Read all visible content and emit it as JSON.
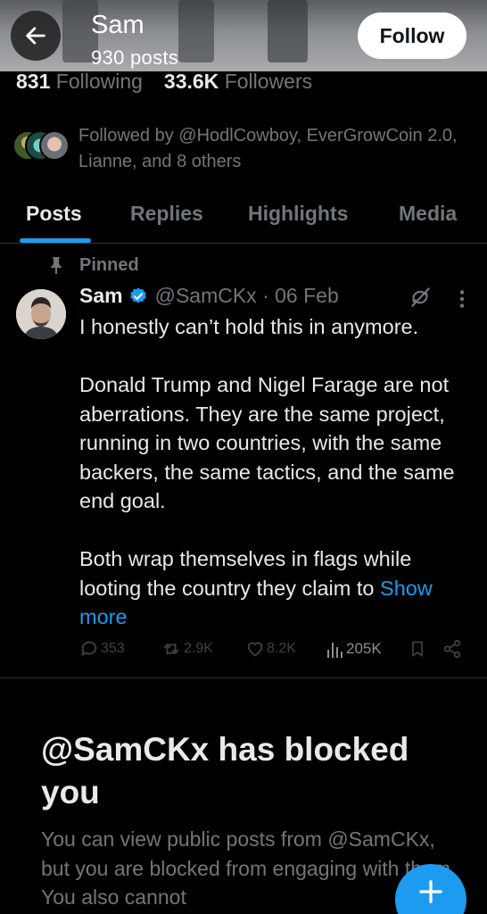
{
  "header": {
    "name": "Sam",
    "posts_count": "930 posts",
    "follow_label": "Follow"
  },
  "stats": {
    "following_count": "831",
    "following_label": "Following",
    "followers_count": "33.6K",
    "followers_label": "Followers"
  },
  "followed_by": {
    "text": "Followed by @HodlCowboy, EverGrowCoin 2.0, Lianne, and 8 others"
  },
  "tabs": [
    {
      "label": "Posts",
      "active": true
    },
    {
      "label": "Replies",
      "active": false
    },
    {
      "label": "Highlights",
      "active": false
    },
    {
      "label": "Media",
      "active": false
    }
  ],
  "post": {
    "pinned_label": "Pinned",
    "author_name": "Sam",
    "handle_date": "@SamCKx · 06 Feb",
    "paragraphs": [
      "I honestly can’t hold this in anymore.",
      "Donald Trump and Nigel Farage are not aberrations. They are the same project, running in two countries, with the same backers, the same tactics, and the same end goal.",
      "Both wrap themselves in flags while looting the country they claim to"
    ],
    "show_more": "Show more",
    "actions": {
      "replies": "353",
      "reposts": "2.9K",
      "likes": "8.2K",
      "views": "205K"
    }
  },
  "blocked": {
    "title": "@SamCKx has blocked you",
    "text": "You can view public posts from @SamCKx, but you are blocked from engaging with them. You also cannot"
  },
  "colors": {
    "accent": "#1d9bf0",
    "background": "#000000",
    "text_primary": "#e7e9ea",
    "text_secondary": "#71767b"
  },
  "icons": {
    "back": "arrow-left-icon",
    "pin": "pin-icon",
    "verified": "verified-badge-icon",
    "grok": "grok-icon",
    "more": "more-vertical-icon",
    "reply": "reply-icon",
    "repost": "repost-icon",
    "like": "heart-icon",
    "views": "views-icon",
    "bookmark": "bookmark-icon",
    "share": "share-icon",
    "compose": "plus-icon"
  }
}
